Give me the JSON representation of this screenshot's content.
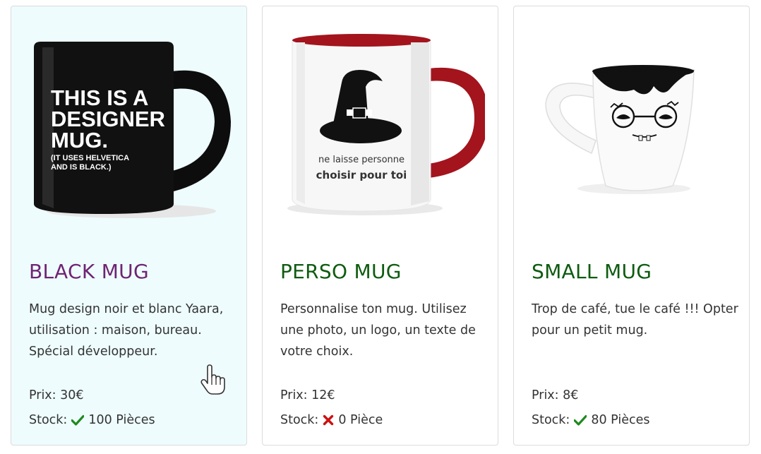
{
  "products": [
    {
      "title": "BLACK MUG",
      "mug_text": [
        "THIS IS A",
        "DESIGNER",
        "MUG.",
        "(IT USES HELVETICA",
        "AND IS BLACK.)"
      ],
      "description": "Mug design noir et blanc Yaara, utilisation : maison, bureau. Spécial développeur.",
      "price": "Prix: 30€",
      "stock_label": "Stock:",
      "stock_icon": "check-icon",
      "stock_value": "100 Pièces",
      "title_color": "#6f2473"
    },
    {
      "title": "PERSO MUG",
      "mug_text": [
        "ne laisse personne",
        "choisir pour toi"
      ],
      "description": "Personnalise ton mug. Utilisez une photo, un logo, un texte de votre choix.",
      "price": "Prix: 12€",
      "stock_label": "Stock:",
      "stock_icon": "cross-icon",
      "stock_value": "0 Pièce",
      "title_color": "#0e5b10"
    },
    {
      "title": "SMALL MUG",
      "description": "Trop de café, tue le café !!! Opter pour un petit mug.",
      "price": "Prix: 8€",
      "stock_label": "Stock:",
      "stock_icon": "check-icon",
      "stock_value": "80 Pièces",
      "title_color": "#0e5b10"
    }
  ],
  "colors": {
    "hover_bg": "#eefcfd",
    "in_stock": "#1e8a1e",
    "out_of_stock": "#cc1111"
  }
}
